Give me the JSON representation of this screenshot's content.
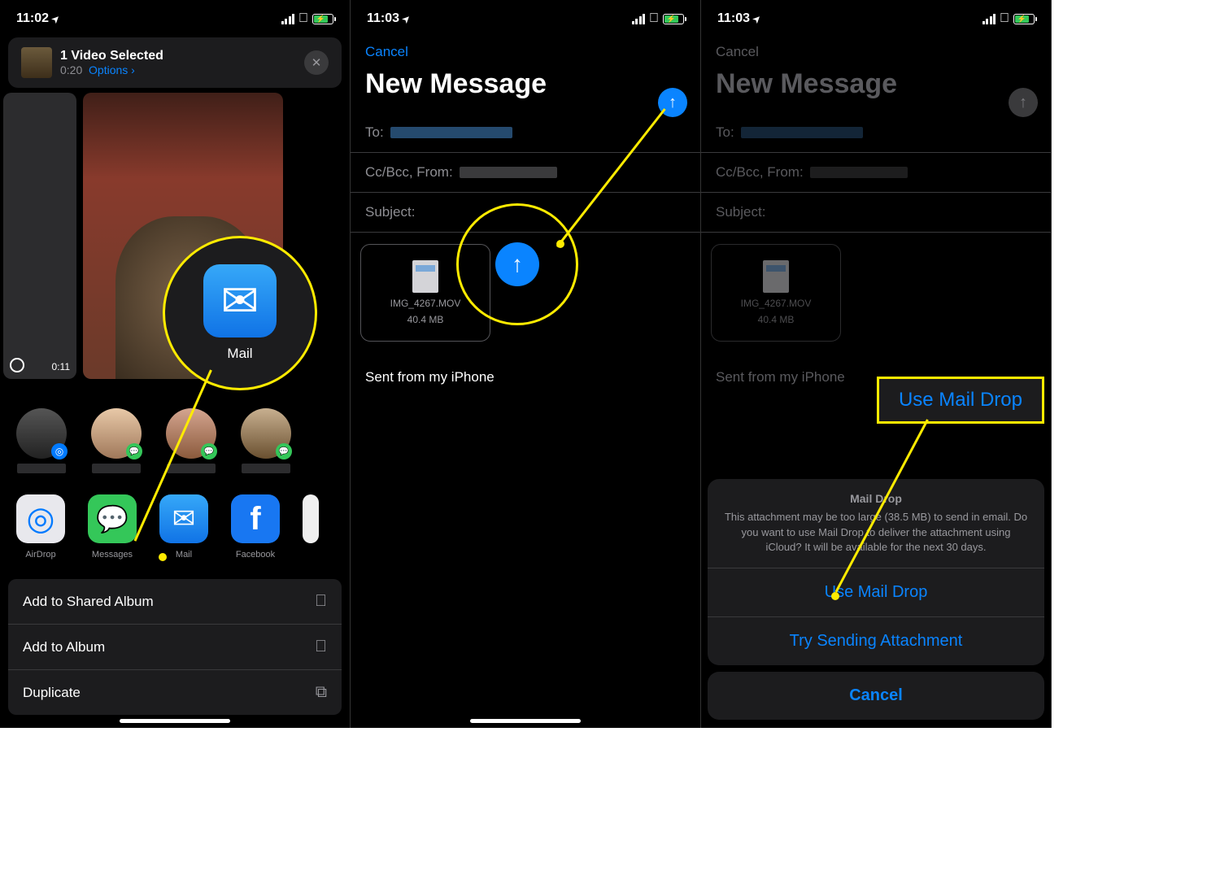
{
  "status": {
    "time1": "11:02",
    "time2": "11:03",
    "time3": "11:03"
  },
  "screen1": {
    "header": {
      "title": "1 Video Selected",
      "duration": "0:20",
      "options": "Options",
      "chev": "›"
    },
    "video_durations": {
      "small": "0:11"
    },
    "apps": {
      "airdrop": "AirDrop",
      "messages": "Messages",
      "mail": "Mail",
      "facebook": "Facebook"
    },
    "actions": {
      "shared": "Add to Shared Album",
      "album": "Add to Album",
      "dup": "Duplicate"
    },
    "callout": "Mail"
  },
  "screen2": {
    "cancel": "Cancel",
    "title": "New Message",
    "to": "To:",
    "ccbcc": "Cc/Bcc, From:",
    "subject": "Subject:",
    "attach": {
      "name": "IMG_4267.MOV",
      "size": "40.4 MB"
    },
    "signature": "Sent from my iPhone"
  },
  "screen3": {
    "cancel": "Cancel",
    "title": "New Message",
    "to": "To:",
    "ccbcc": "Cc/Bcc, From:",
    "subject": "Subject:",
    "attach": {
      "name": "IMG_4267.MOV",
      "size": "40.4 MB"
    },
    "signature": "Sent from my iPhone",
    "sheet": {
      "title": "Mail Drop",
      "body": "This attachment may be too large (38.5 MB) to send in email. Do you want to use Mail Drop to deliver the attachment using iCloud? It will be available for the next 30 days.",
      "opt1": "Use Mail Drop",
      "opt2": "Try Sending Attachment",
      "cancel": "Cancel"
    },
    "callout": "Use Mail Drop"
  }
}
